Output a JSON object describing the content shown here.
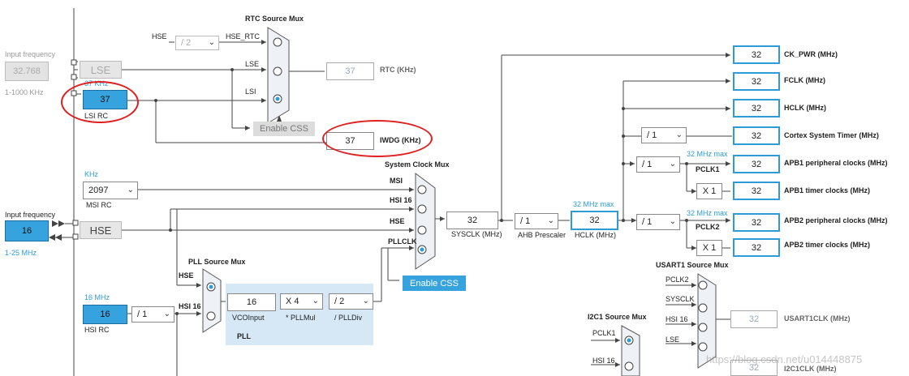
{
  "left": {
    "lse_input_label": "Input frequency",
    "lse_input_value": "32.768",
    "lse_input_range": "1-1000 KHz",
    "lse_label": "LSE",
    "lsi_freq": "37 KHz",
    "lsi_value": "37",
    "lsi_label": "LSI RC",
    "msi_unit": "KHz",
    "msi_value": "2097",
    "msi_label": "MSI RC",
    "hse_input_label": "Input frequency",
    "hse_input_value": "16",
    "hse_input_range": "1-25 MHz",
    "hse_label": "HSE",
    "hsi_freq": "16 MHz",
    "hsi_value": "16",
    "hsi_label": "HSI RC",
    "hsi_div": "/ 1"
  },
  "rtc": {
    "title": "RTC Source Mux",
    "hse_label": "HSE",
    "hse_div": "/ 2",
    "in_hse": "HSE_RTC",
    "in_lse": "LSE",
    "in_lsi": "LSI",
    "output_value": "37",
    "output_label": "RTC (KHz)",
    "enable_css": "Enable CSS",
    "iwdg_value": "37",
    "iwdg_label": "IWDG (KHz)"
  },
  "sysclk_mux": {
    "title": "System Clock Mux",
    "in_msi": "MSI",
    "in_hsi": "HSI 16",
    "in_hse": "HSE",
    "in_pll": "PLLCLK",
    "sysclk_value": "32",
    "sysclk_label": "SYSCLK (MHz)",
    "ahb_div": "/ 1",
    "ahb_label": "AHB Prescaler",
    "hclk_max": "32 MHz max",
    "hclk_value": "32",
    "hclk_label": "HCLK (MHz)",
    "enable_css": "Enable CSS"
  },
  "pll": {
    "mux_title": "PLL Source Mux",
    "in_hse": "HSE",
    "in_hsi": "HSI 16",
    "vco_value": "16",
    "vco_label": "VCOInput",
    "mul_value": "X 4",
    "mul_label": "* PLLMul",
    "div_value": "/ 2",
    "div_label": "/ PLLDiv",
    "panel_label": "PLL"
  },
  "outputs": {
    "ck_pwr_value": "32",
    "ck_pwr_label": "CK_PWR (MHz)",
    "fclk_value": "32",
    "fclk_label": "FCLK (MHz)",
    "hclk_value": "32",
    "hclk_label": "HCLK (MHz)",
    "cortex_div": "/ 1",
    "cortex_value": "32",
    "cortex_label": "Cortex System Timer (MHz)",
    "apb1_max": "32 MHz max",
    "apb1_div": "/ 1",
    "pclk1": "PCLK1",
    "apb1_value": "32",
    "apb1_label": "APB1 peripheral clocks (MHz)",
    "apb1_mul": "X 1",
    "apb1_timer_value": "32",
    "apb1_timer_label": "APB1 timer clocks (MHz)",
    "apb2_max": "32 MHz max",
    "apb2_div": "/ 1",
    "pclk2": "PCLK2",
    "apb2_value": "32",
    "apb2_label": "APB2 peripheral clocks (MHz)",
    "apb2_mul": "X 1",
    "apb2_timer_value": "32",
    "apb2_timer_label": "APB2 timer clocks (MHz)"
  },
  "usart": {
    "title": "USART1 Source Mux",
    "in_pclk2": "PCLK2",
    "in_sysclk": "SYSCLK",
    "in_hsi": "HSI 16",
    "in_lse": "LSE",
    "output_value": "32",
    "output_label": "USART1CLK (MHz)"
  },
  "i2c": {
    "title": "I2C1 Source Mux",
    "in_pclk1": "PCLK1",
    "in_hsi": "HSI 16",
    "output_value": "32",
    "output_label": "I2C1CLK (MHz)"
  },
  "watermark": "https://blog.csdn.net/u014448875"
}
